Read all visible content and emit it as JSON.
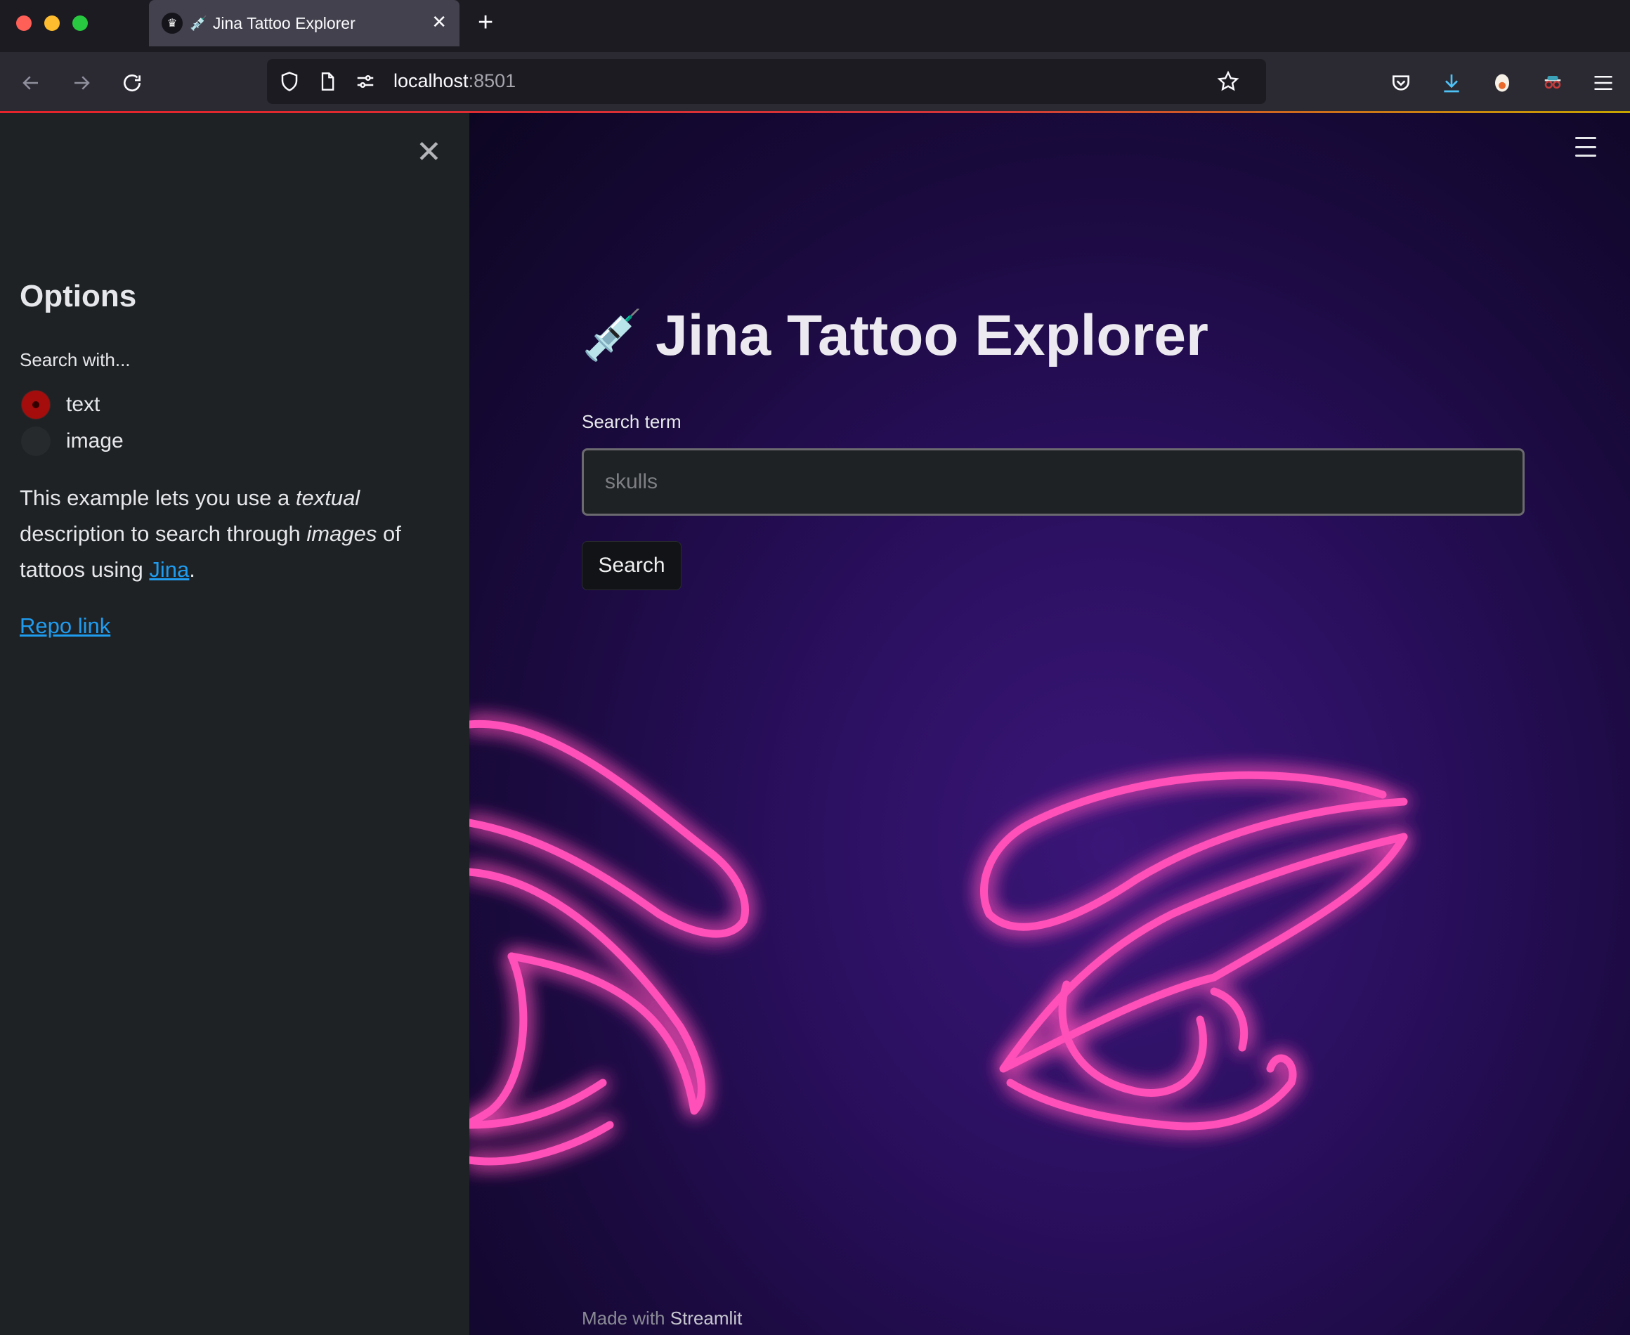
{
  "browser": {
    "tab_title": "Jina Tattoo Explorer",
    "tab_emoji": "💉",
    "url_host": "localhost",
    "url_port": ":8501",
    "icons": [
      "back-icon",
      "forward-icon",
      "reload-icon",
      "shield-icon",
      "page-icon",
      "permissions-icon",
      "bookmark-star-icon",
      "pocket-icon",
      "download-icon",
      "extension-icon",
      "extension-icon",
      "menu-icon"
    ]
  },
  "sidebar": {
    "title": "Options",
    "radio_label": "Search with...",
    "options": [
      {
        "label": "text",
        "selected": true
      },
      {
        "label": "image",
        "selected": false
      }
    ],
    "desc_prefix": "This example lets you use a ",
    "desc_em1": "textual",
    "desc_mid": " description to search through ",
    "desc_em2": "images",
    "desc_suffix": " of tattoos using ",
    "desc_link": "Jina",
    "desc_end": ".",
    "repo_link": "Repo link"
  },
  "main": {
    "title_emoji": "💉",
    "title": "Jina Tattoo Explorer",
    "search_label": "Search term",
    "search_placeholder": "skulls",
    "search_value": "",
    "search_button": "Search",
    "footer_prefix": "Made with ",
    "footer_brand": "Streamlit"
  },
  "colors": {
    "accent": "#a50d0d",
    "link": "#1f9cf0",
    "neon": "#ff4fb8"
  }
}
